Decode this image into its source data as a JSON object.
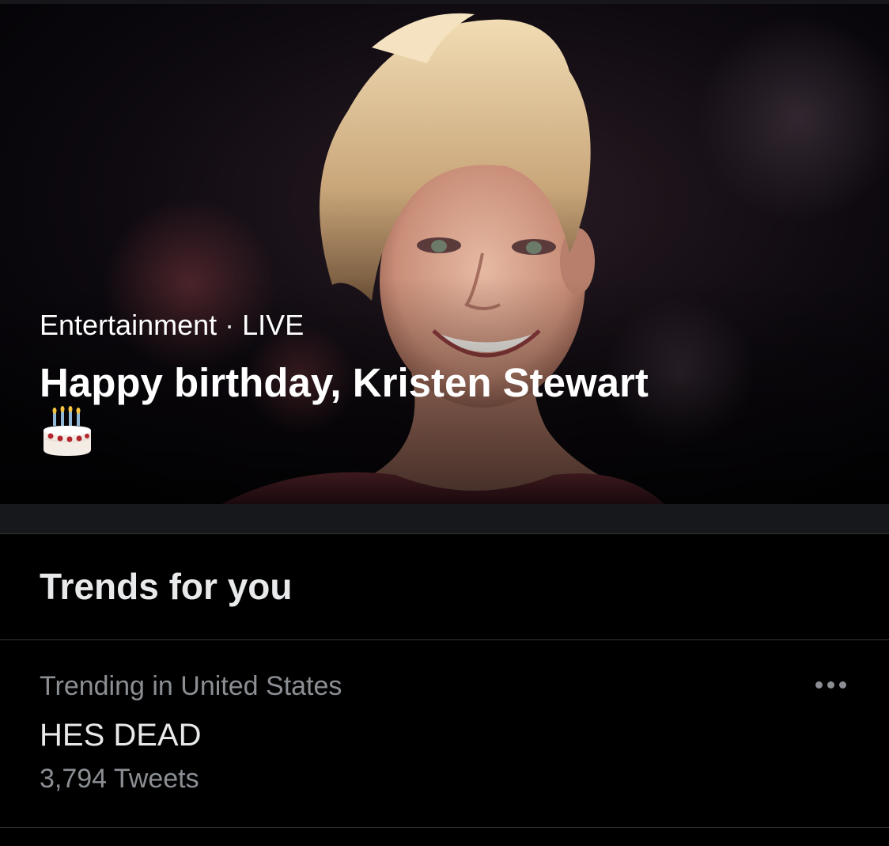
{
  "hero": {
    "category": "Entertainment",
    "separator": "·",
    "status": "LIVE",
    "headline": "Happy birthday, Kristen Stewart",
    "emoji_icon": "birthday-cake-icon",
    "image": "portrait photo of a smiling woman with short blonde hair"
  },
  "trends": {
    "title": "Trends for you",
    "items": [
      {
        "context": "Trending in United States",
        "name": "HES DEAD",
        "count": "3,794 Tweets",
        "more_icon": "more-horizontal-icon"
      }
    ]
  },
  "colors": {
    "background": "#000000",
    "band": "#16181c",
    "divider": "#2f3336",
    "primary_text": "#e7e9ea",
    "secondary_text": "#8b8f94"
  }
}
